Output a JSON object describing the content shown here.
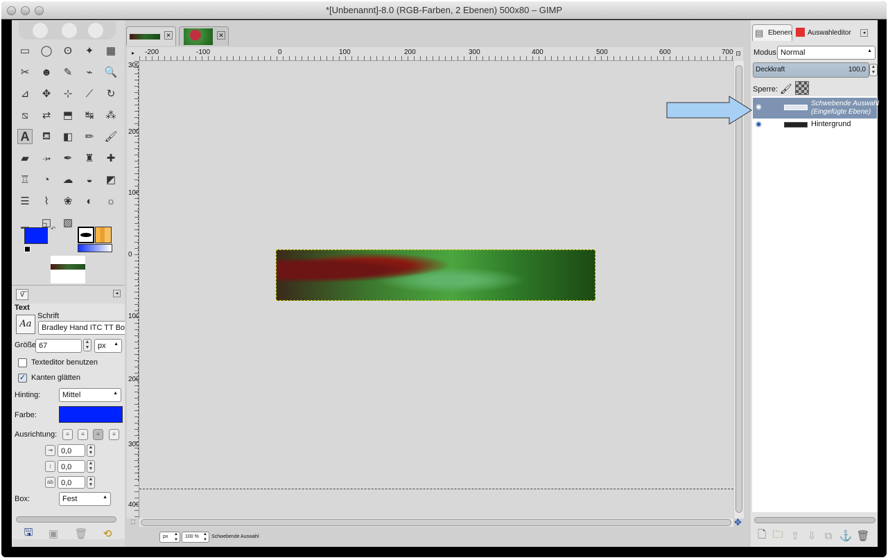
{
  "window": {
    "title": "*[Unbenannt]-8.0 (RGB-Farben, 2 Ebenen) 500x80 – GIMP"
  },
  "toolbox": {
    "tools": [
      "rect-select-icon",
      "ellipse-select-icon",
      "free-select-icon",
      "fuzzy-select-icon",
      "color-select-icon",
      "scissors-icon",
      "foreground-select-icon",
      "paths-icon",
      "color-picker-icon",
      "zoom-icon",
      "measure-icon",
      "move-icon",
      "align-icon",
      "transform-icon",
      "rotate-icon",
      "perspective-icon",
      "flip-icon",
      "cage-icon",
      "warp-icon",
      "3d-icon",
      "text-tool-icon",
      "bucket-fill-icon",
      "blend-icon",
      "pencil-icon",
      "paintbrush-icon",
      "eraser-icon",
      "airbrush-icon",
      "ink-icon",
      "clone-icon",
      "heal-icon",
      "perspective-clone-icon",
      "smudge-icon",
      "blur-icon",
      "dodge-burn-icon",
      "color-balance-icon",
      "levels-icon",
      "curves-icon",
      "hue-saturation-icon",
      "threshold-icon",
      "brightness-icon",
      "histogram-icon",
      "desaturate-icon",
      "gradient-map-icon"
    ],
    "fg_color": "#0022ff",
    "bg_color": "#ffffff"
  },
  "tool_options": {
    "title": "Text",
    "font_label": "Schrift",
    "font_value": "Bradley Hand ITC TT Bold",
    "font_preview": "Aa",
    "size_label": "Größe:",
    "size_value": "67",
    "size_unit": "px",
    "use_editor_label": "Texteditor benutzen",
    "use_editor_checked": false,
    "antialias_label": "Kanten glätten",
    "antialias_checked": true,
    "hinting_label": "Hinting:",
    "hinting_value": "Mittel",
    "color_label": "Farbe:",
    "color_value": "#0022ff",
    "justify_label": "Ausrichtung:",
    "indent_value": "0,0",
    "line_spacing_value": "0,0",
    "letter_spacing_value": "0,0",
    "box_label": "Box:",
    "box_value": "Fest"
  },
  "ruler": {
    "h_labels": [
      "-200",
      "-100",
      "0",
      "100",
      "200",
      "300",
      "400",
      "500",
      "600",
      "700"
    ],
    "v_labels": [
      "300",
      "200",
      "100",
      "0",
      "100",
      "200",
      "300",
      "400"
    ]
  },
  "statusbar": {
    "unit": "px",
    "zoom": "100 %",
    "message": "Schwebende Auswahl"
  },
  "layers_panel": {
    "tab_layers": "Ebenen",
    "tab_selection": "Auswahleditor",
    "mode_label": "Modus:",
    "mode_value": "Normal",
    "opacity_label": "Deckkraft",
    "opacity_value": "100,0",
    "opacity_fraction": 1.0,
    "lock_label": "Sperre:",
    "layers": [
      {
        "name": "Schwebende Auswahl",
        "sub": "(Eingefügte Ebene)",
        "selected": true
      },
      {
        "name": "Hintergrund",
        "sub": "",
        "selected": false
      }
    ],
    "arrow_color": "#a8d0f5",
    "selected_row_color": "#7d93b1"
  }
}
